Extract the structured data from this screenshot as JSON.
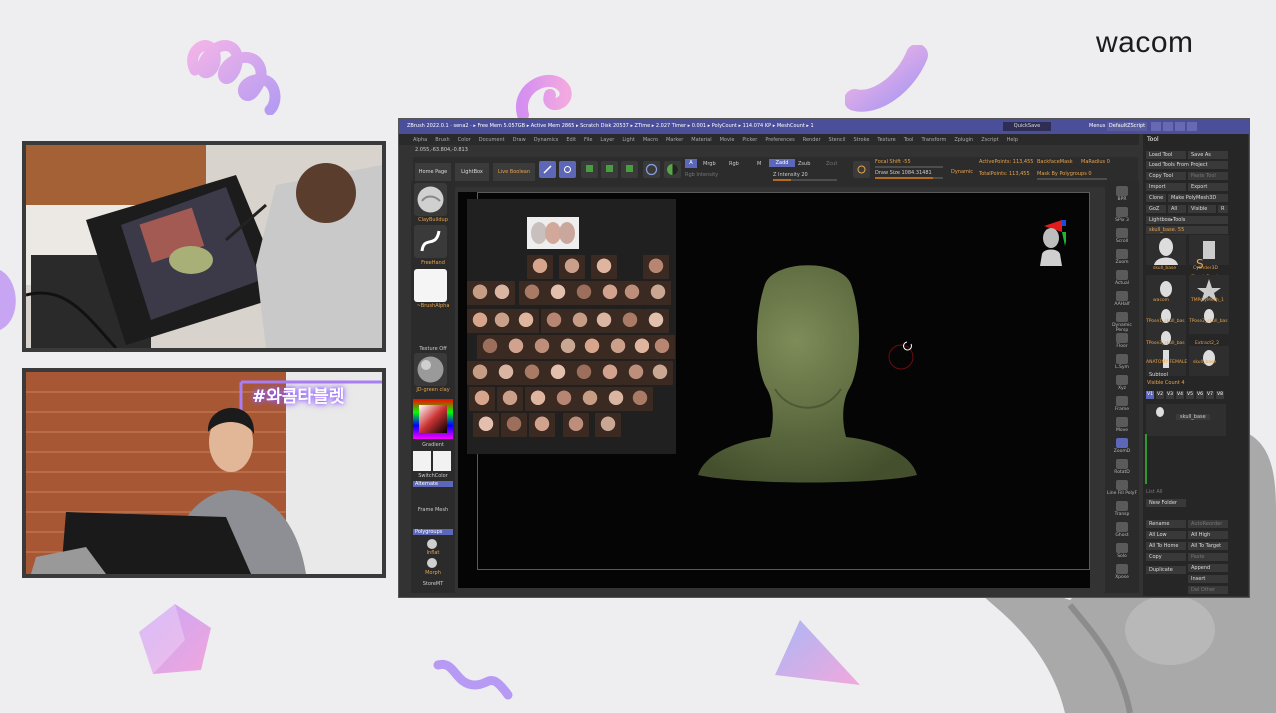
{
  "brand": {
    "logo_text": "wacom"
  },
  "webcam_top": {
    "label": "drawing-tablet-overhead-camera"
  },
  "webcam_bottom": {
    "overlay_text": "#와콤타블렛"
  },
  "zbrush": {
    "title_text": "ZBrush 2022.0.1 · sena2 · ▸ Free Mem 5.057GB ▸ Active Mem 2865 ▸ Scratch Disk 20537 ▸ ZTime ▸ 2.027 Timer ▸ 0.001 ▸ PolyCount ▸ 114.074 KP ▸ MeshCount ▸ 1",
    "quicksave": "QuickSave",
    "menus_label": "Menus",
    "ui_label": "DefaultZScript",
    "menu": [
      "Alpha",
      "Brush",
      "Color",
      "Document",
      "Draw",
      "Dynamics",
      "Edit",
      "File",
      "Layer",
      "Light",
      "Macro",
      "Marker",
      "Material",
      "Movie",
      "Picker",
      "Preferences",
      "Render",
      "Stencil",
      "Stroke",
      "Texture",
      "Tool",
      "Transform",
      "Zplugin",
      "Zscript",
      "Help"
    ],
    "coords": "2.055,-63.804,-0.813",
    "top": {
      "home_page": "Home Page",
      "lightbox": "LightBox",
      "live_boolean": "Live Boolean",
      "edit": "Edit",
      "draw": "Draw",
      "move": "Move",
      "scale": "Scale",
      "rotate": "Rotate",
      "a": "A",
      "mrgb": "Mrgb",
      "rgb": "Rgb",
      "m": "M",
      "zadd": "Zadd",
      "zsub": "Zsub",
      "zcut": "Zcut",
      "rgb_intensity": "Rgb Intensity",
      "z_intensity": "Z Intensity 20",
      "focal_shift": "Focal Shift -55",
      "draw_size": "Draw Size 1084.31481",
      "dynamic": "Dynamic",
      "active_points": "ActivePoints: 113,455",
      "total_points": "TotalPoints: 113,455",
      "backface_mask": "BackfaceMask",
      "mask_by_polygroups": "Mask By Polygroups 0",
      "mcolor": "MaRadius 0"
    },
    "left": {
      "brush1": "ClayBuildup",
      "brush2": "FreeHand",
      "alpha": "~BrushAlpha",
      "texture": "Texture Off",
      "material": "JD-green clay",
      "gradient": "Gradient",
      "switch_color": "SwitchColor",
      "alternate": "Alternate",
      "frame_mesh": "Frame Mesh",
      "polygroups": "Polygroups",
      "inflat": "Inflat",
      "morph": "Morph",
      "storemt": "StoreMT"
    },
    "right_shelf": [
      "BPR",
      "SPix 3",
      "Scroll",
      "Zoom",
      "Actual",
      "AAHalf",
      "Dynamic Persp",
      "Floor",
      "L.Sym",
      "Xyz",
      "Frame",
      "Move",
      "ZoomD",
      "RotatD",
      "Line Fill PolyF",
      "Transp",
      "Ghost",
      "Solo",
      "Xpose"
    ],
    "tool": {
      "header": "Tool",
      "load_tool": "Load Tool",
      "save_as": "Save As",
      "load_from_project": "Load Tools From Project",
      "copy_tool": "Copy Tool",
      "paste_tool": "Paste Tool",
      "import": "Import",
      "export": "Export",
      "clone": "Clone",
      "make_polymesh": "Make PolyMesh3D",
      "goz": "GoZ",
      "all": "All",
      "visible": "Visible",
      "r": "R",
      "lightbox_tools": "Lightbox▸Tools",
      "current_tool": "skull_base. 55",
      "items": [
        "skull_base",
        "Cylinder3D",
        "SimpleBrush",
        "wacom",
        "TMPolyMesh_1",
        "TPose1_skull_bas",
        "TPose2_skull_bas",
        "TPose3_skull_bas",
        "Extract2_2",
        "ANATOMY FEMALE",
        "skull_base"
      ],
      "subtool": "Subtool",
      "visible_count": "Visible Count 4",
      "versions": [
        "V1",
        "V2",
        "V3",
        "V4",
        "V5",
        "V6",
        "V7",
        "V8"
      ],
      "subtool_item": "skull_base",
      "list_all": "List All",
      "new_folder": "New Folder",
      "rename": "Rename",
      "autoreorder": "AutoReorder",
      "all_low": "All Low",
      "all_high": "All High",
      "all_to_home": "All To Home",
      "all_to_target": "All To Target",
      "copy": "Copy",
      "paste": "Paste",
      "duplicate": "Duplicate",
      "append": "Append",
      "insert": "Insert",
      "delete": "Del Other"
    }
  }
}
